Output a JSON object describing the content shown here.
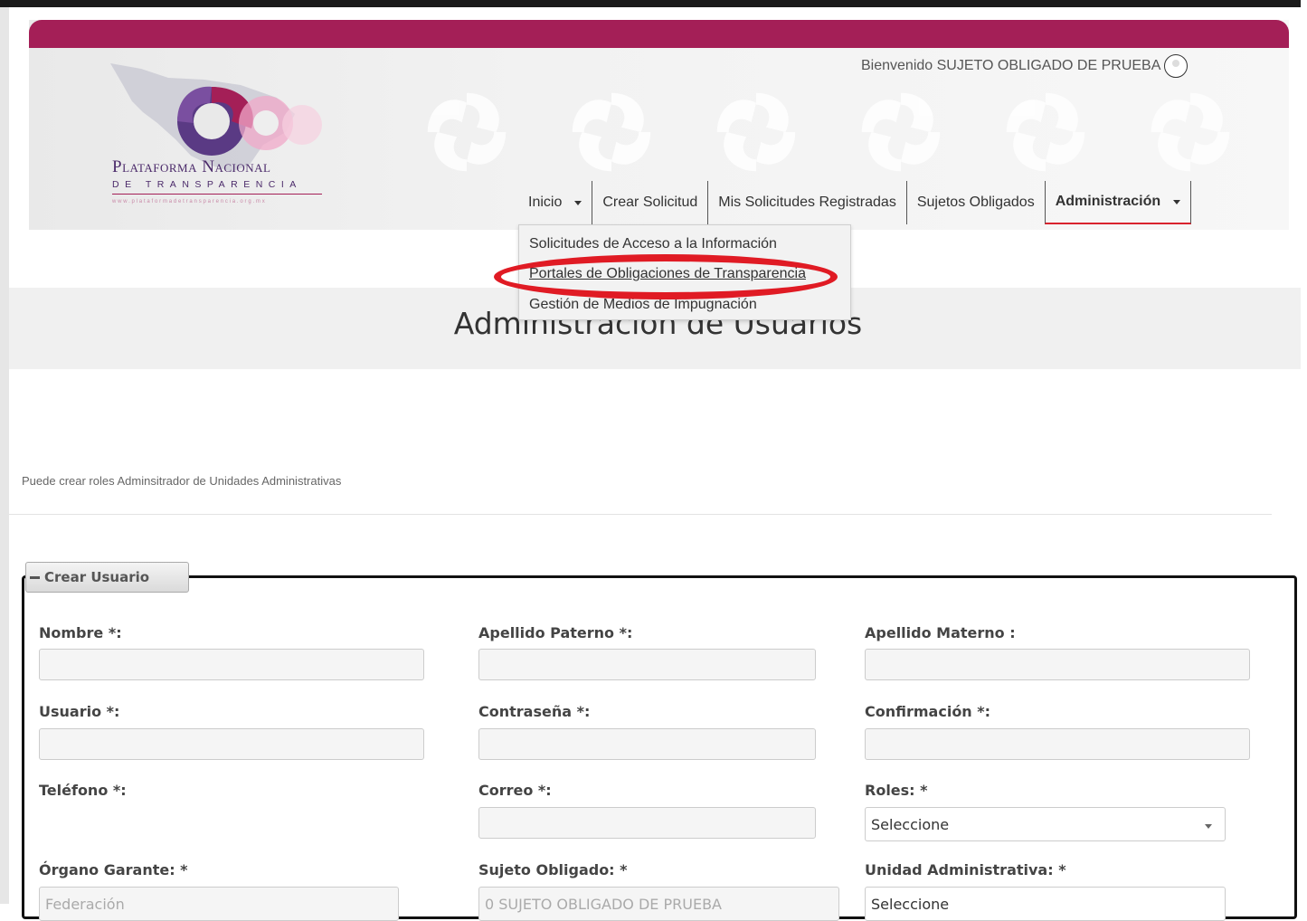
{
  "header": {
    "logo_title": "Plataforma Nacional",
    "logo_subtitle": "de Transparencia",
    "logo_url": "www.plataformadetransparencia.org.mx",
    "welcome": "Bienvenido SUJETO OBLIGADO DE PRUEBA",
    "brand_color": "#a41f57"
  },
  "nav": {
    "items": [
      {
        "label": "Inicio"
      },
      {
        "label": "Crear Solicitud"
      },
      {
        "label": "Mis Solicitudes Registradas"
      },
      {
        "label": "Sujetos Obligados"
      },
      {
        "label": "Administración"
      }
    ],
    "dropdown": [
      {
        "label": "Solicitudes de Acceso a la Información"
      },
      {
        "label": "Portales de Obligaciones de Transparencia"
      },
      {
        "label": "Gestión de Medios de Impugnación"
      }
    ]
  },
  "page": {
    "title": "Administración de Usuarios",
    "info": "Puede crear roles Adminsitrador de Unidades Administrativas"
  },
  "form": {
    "legend": "Crear Usuario",
    "labels": {
      "nombre": "Nombre *:",
      "apellido_paterno": "Apellido Paterno *:",
      "apellido_materno": "Apellido Materno :",
      "usuario": "Usuario *:",
      "contrasena": "Contraseña *:",
      "confirmacion": "Confirmación *:",
      "telefono": "Teléfono *:",
      "correo": "Correo *:",
      "roles": "Roles: *",
      "organo_garante": "Órgano Garante: *",
      "sujeto_obligado": "Sujeto Obligado: *",
      "unidad_administrativa": "Unidad Administrativa: *"
    },
    "values": {
      "roles": "Seleccione",
      "organo_garante": "Federación",
      "sujeto_obligado": "0 SUJETO OBLIGADO DE PRUEBA",
      "unidad_administrativa": "Seleccione"
    }
  }
}
